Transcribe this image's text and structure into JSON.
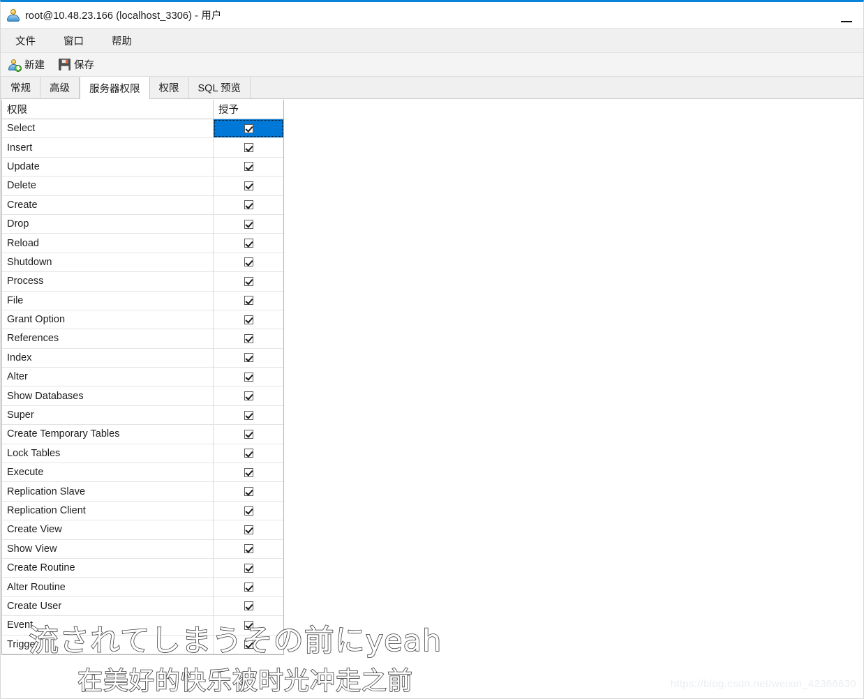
{
  "window": {
    "title": "root@10.48.23.166 (localhost_3306) - 用户",
    "icon": "user-icon",
    "minimize_label": "—"
  },
  "menubar": {
    "items": [
      {
        "label": "文件"
      },
      {
        "label": "窗口"
      },
      {
        "label": "帮助"
      }
    ]
  },
  "toolbar": {
    "new_label": "新建",
    "save_label": "保存"
  },
  "tabs": [
    {
      "label": "常规",
      "active": false
    },
    {
      "label": "高级",
      "active": false
    },
    {
      "label": "服务器权限",
      "active": true
    },
    {
      "label": "权限",
      "active": false
    },
    {
      "label": "SQL 预览",
      "active": false
    }
  ],
  "grid": {
    "columns": [
      "权限",
      "授予"
    ],
    "selected_row_index": 0,
    "rows": [
      {
        "privilege": "Select",
        "granted": true
      },
      {
        "privilege": "Insert",
        "granted": true
      },
      {
        "privilege": "Update",
        "granted": true
      },
      {
        "privilege": "Delete",
        "granted": true
      },
      {
        "privilege": "Create",
        "granted": true
      },
      {
        "privilege": "Drop",
        "granted": true
      },
      {
        "privilege": "Reload",
        "granted": true
      },
      {
        "privilege": "Shutdown",
        "granted": true
      },
      {
        "privilege": "Process",
        "granted": true
      },
      {
        "privilege": "File",
        "granted": true
      },
      {
        "privilege": "Grant Option",
        "granted": true
      },
      {
        "privilege": "References",
        "granted": true
      },
      {
        "privilege": "Index",
        "granted": true
      },
      {
        "privilege": "Alter",
        "granted": true
      },
      {
        "privilege": "Show Databases",
        "granted": true
      },
      {
        "privilege": "Super",
        "granted": true
      },
      {
        "privilege": "Create Temporary Tables",
        "granted": true
      },
      {
        "privilege": "Lock Tables",
        "granted": true
      },
      {
        "privilege": "Execute",
        "granted": true
      },
      {
        "privilege": "Replication Slave",
        "granted": true
      },
      {
        "privilege": "Replication Client",
        "granted": true
      },
      {
        "privilege": "Create View",
        "granted": true
      },
      {
        "privilege": "Show View",
        "granted": true
      },
      {
        "privilege": "Create Routine",
        "granted": true
      },
      {
        "privilege": "Alter Routine",
        "granted": true
      },
      {
        "privilege": "Create User",
        "granted": true
      },
      {
        "privilege": "Event",
        "granted": true
      },
      {
        "privilege": "Trigger",
        "granted": true
      }
    ]
  },
  "overlay": {
    "subtitle_line1": "流されてしまうその前にyeah",
    "subtitle_line2": "在美好的快乐被时光冲走之前",
    "watermark": "https://blog.csdn.net/weixin_42366630"
  },
  "colors": {
    "accent": "#0a84d8",
    "selection": "#0078d7",
    "toolbar_bg": "#f4f4f4",
    "menu_bg": "#f0f0f0"
  }
}
